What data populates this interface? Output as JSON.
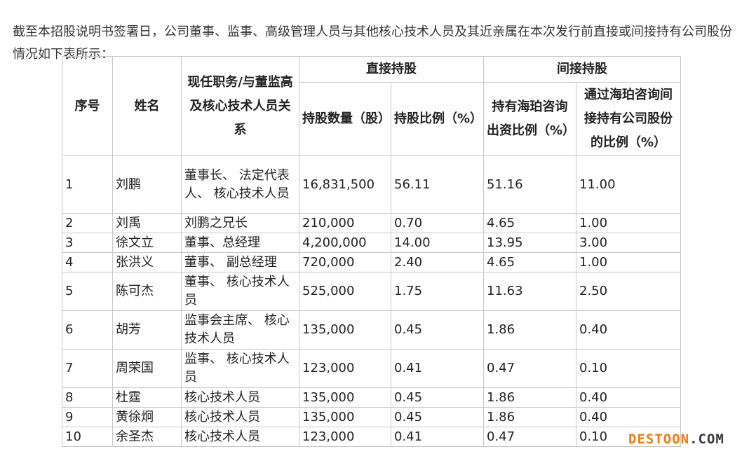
{
  "intro": "截至本招股说明书签署日，公司董事、监事、高级管理人员与其他核心技术人员及其近亲属在本次发行前直接或间接持有公司股份情况如下表所示：",
  "table": {
    "headers": {
      "seq": "序号",
      "name": "姓名",
      "role": "现任职务/与董监高及核心技术人员关系",
      "direct": "直接持股",
      "indirect": "间接持股",
      "direct_shares": "持股数量（股）",
      "direct_ratio": "持股比例（%）",
      "indirect_contrib": "持有海珀咨询出资比例（%）",
      "indirect_ratio": "通过海珀咨询间接持有公司股份的比例（%）"
    },
    "rows": [
      {
        "seq": "1",
        "name": "刘鹏",
        "role": "董事长、 法定代表人、 核心技术人员",
        "shares": "16,831,500",
        "ratio": "56.11",
        "contrib": "51.16",
        "indirect": "11.00"
      },
      {
        "seq": "2",
        "name": "刘禹",
        "role": "刘鹏之兄长",
        "shares": "210,000",
        "ratio": "0.70",
        "contrib": "4.65",
        "indirect": "1.00"
      },
      {
        "seq": "3",
        "name": "徐文立",
        "role": "董事、总经理",
        "shares": "4,200,000",
        "ratio": "14.00",
        "contrib": "13.95",
        "indirect": "3.00"
      },
      {
        "seq": "4",
        "name": "张洪义",
        "role": "董事、 副总经理",
        "shares": "720,000",
        "ratio": "2.40",
        "contrib": "4.65",
        "indirect": "1.00"
      },
      {
        "seq": "5",
        "name": "陈可杰",
        "role": "董事、 核心技术人员",
        "shares": "525,000",
        "ratio": "1.75",
        "contrib": "11.63",
        "indirect": "2.50"
      },
      {
        "seq": "6",
        "name": "胡芳",
        "role": "监事会主席、 核心技术人员",
        "shares": "135,000",
        "ratio": "0.45",
        "contrib": "1.86",
        "indirect": "0.40"
      },
      {
        "seq": "7",
        "name": "周荣国",
        "role": "监事、 核心技术人员",
        "shares": "123,000",
        "ratio": "0.41",
        "contrib": "0.47",
        "indirect": "0.10"
      },
      {
        "seq": "8",
        "name": "杜霆",
        "role": "核心技术人员",
        "shares": "135,000",
        "ratio": "0.45",
        "contrib": "1.86",
        "indirect": "0.40"
      },
      {
        "seq": "9",
        "name": "黄徐炯",
        "role": "核心技术人员",
        "shares": "135,000",
        "ratio": "0.45",
        "contrib": "1.86",
        "indirect": "0.40"
      },
      {
        "seq": "10",
        "name": "余圣杰",
        "role": "核心技术人员",
        "shares": "123,000",
        "ratio": "0.41",
        "contrib": "0.47",
        "indirect": "0.10"
      }
    ]
  },
  "watermark": {
    "part1": "DESTOON",
    "part2": ".COM"
  }
}
